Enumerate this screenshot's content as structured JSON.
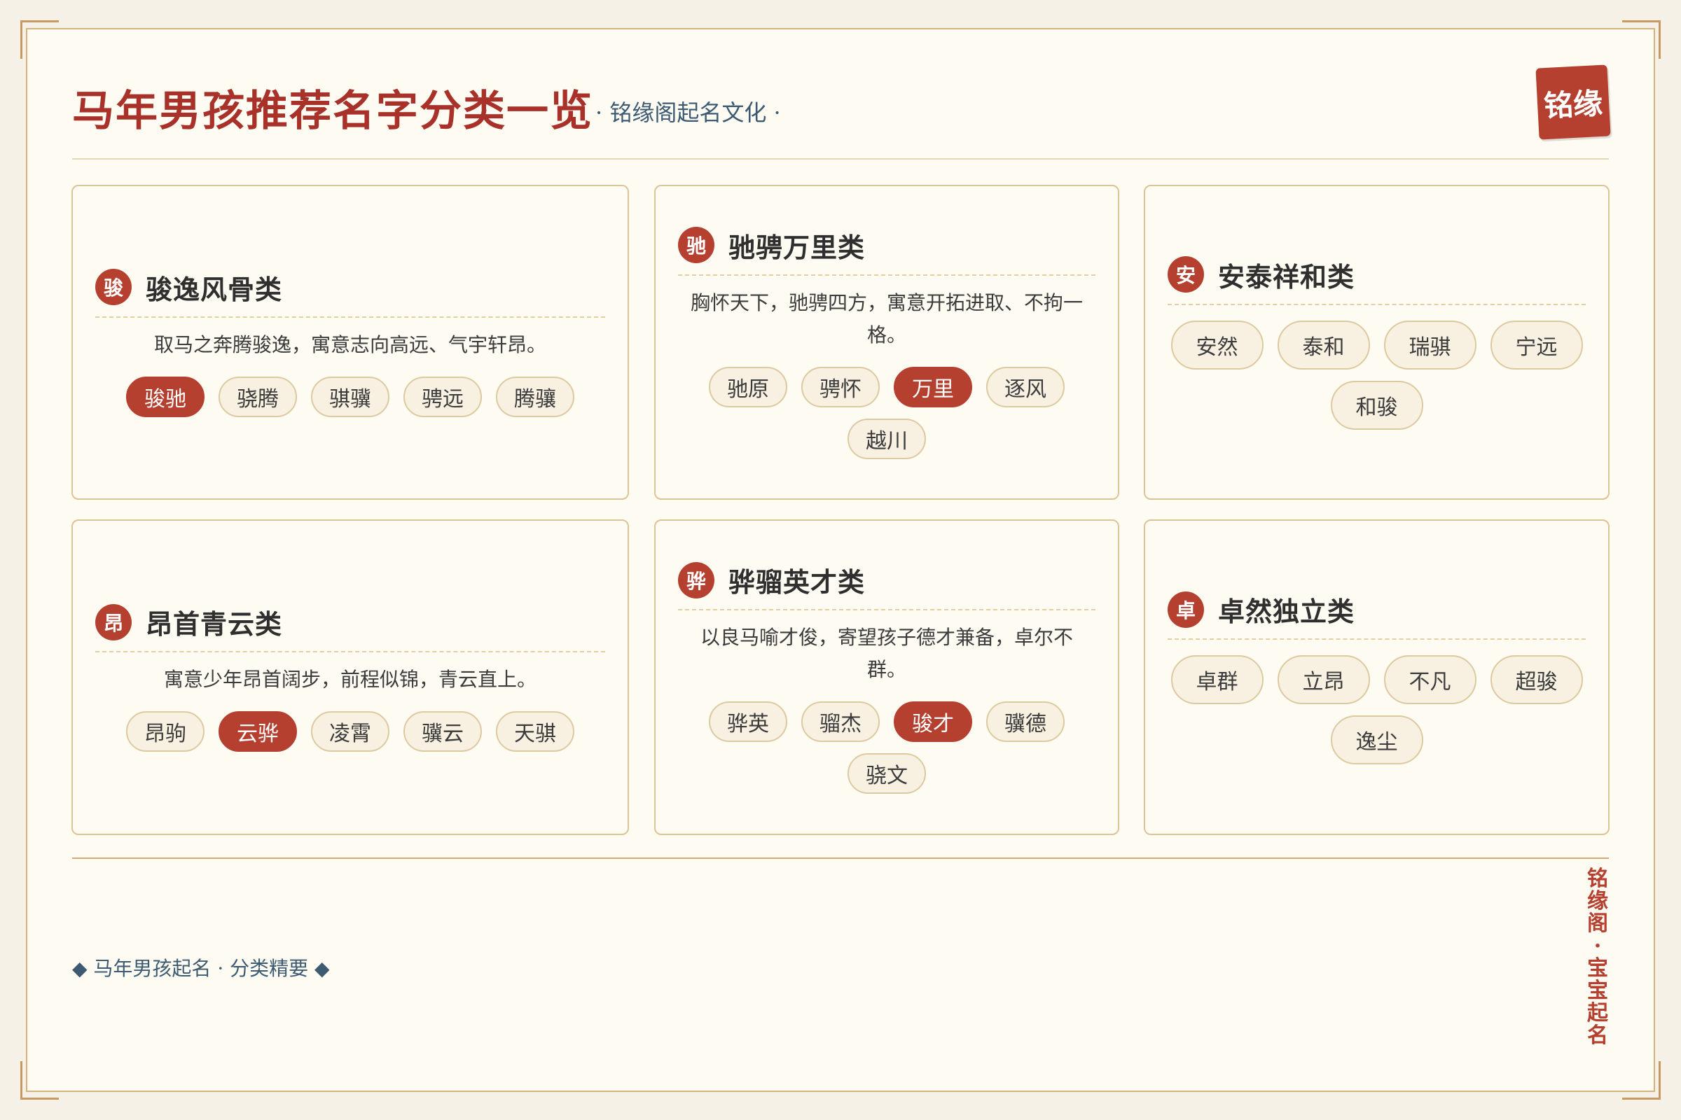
{
  "header": {
    "title": "马年男孩推荐名字分类一览",
    "subtitle": "· 铭缘阁起名文化 ·",
    "seal": "铭缘"
  },
  "cards": [
    {
      "badge": "骏",
      "title": "骏逸风骨类",
      "desc": "取马之奔腾骏逸，寓意志向高远、气宇轩昂。",
      "names": [
        "骏驰",
        "骁腾",
        "骐骥",
        "骋远",
        "腾骧"
      ],
      "active": 0
    },
    {
      "badge": "驰",
      "title": "驰骋万里类",
      "desc": "胸怀天下，驰骋四方，寓意开拓进取、不拘一格。",
      "names": [
        "驰原",
        "骋怀",
        "万里",
        "逐风",
        "越川"
      ],
      "active": 2
    },
    {
      "badge": "安",
      "title": "安泰祥和类",
      "desc": "",
      "names": [
        "安然",
        "泰和",
        "瑞骐",
        "宁远",
        "和骏"
      ],
      "active": -1
    },
    {
      "badge": "昂",
      "title": "昂首青云类",
      "desc": "寓意少年昂首阔步，前程似锦，青云直上。",
      "names": [
        "昂驹",
        "云骅",
        "凌霄",
        "骥云",
        "天骐"
      ],
      "active": 1
    },
    {
      "badge": "骅",
      "title": "骅骝英才类",
      "desc": "以良马喻才俊，寄望孩子德才兼备，卓尔不群。",
      "names": [
        "骅英",
        "骝杰",
        "骏才",
        "骥德",
        "骁文"
      ],
      "active": 2
    },
    {
      "badge": "卓",
      "title": "卓然独立类",
      "desc": "",
      "names": [
        "卓群",
        "立昂",
        "不凡",
        "超骏",
        "逸尘"
      ],
      "active": -1
    }
  ],
  "footer": {
    "left": "◆ 马年男孩起名 · 分类精要 ◆",
    "vertical": "铭缘阁·宝宝起名"
  },
  "colors": {
    "accent": "#b5402f",
    "title": "#a8322a",
    "subtitle": "#3d5a73",
    "border": "#dcc494"
  }
}
